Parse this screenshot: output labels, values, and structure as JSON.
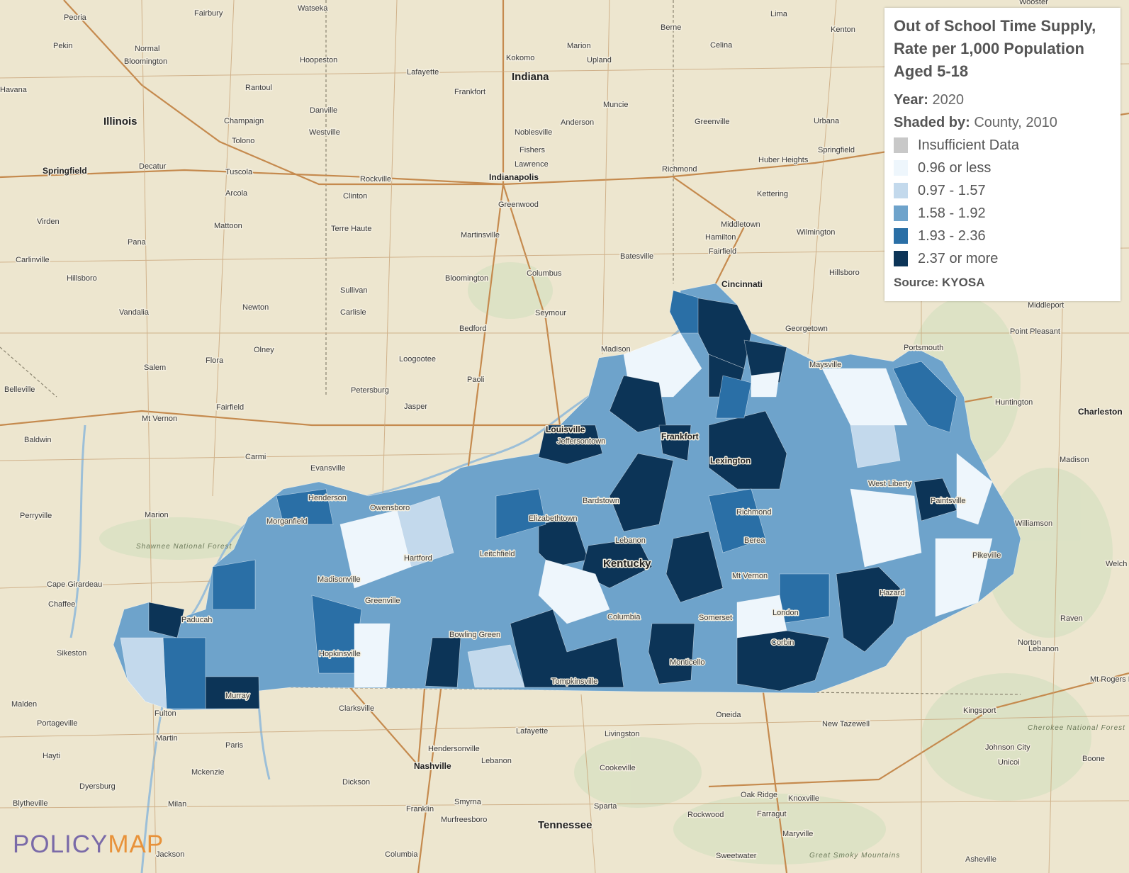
{
  "legend": {
    "title": "Out of School Time Supply, Rate per 1,000 Population Aged 5-18",
    "year_label": "Year:",
    "year_value": "2020",
    "shaded_label": "Shaded by:",
    "shaded_value": "County, 2010",
    "items": [
      {
        "label": "Insufficient Data",
        "color": "#c8c8c8"
      },
      {
        "label": "0.96 or less",
        "color": "#eef6fc"
      },
      {
        "label": "0.97 - 1.57",
        "color": "#c3d9ec"
      },
      {
        "label": "1.58 - 1.92",
        "color": "#6ea3cb"
      },
      {
        "label": "1.93 - 2.36",
        "color": "#2a6fa6"
      },
      {
        "label": "2.37 or more",
        "color": "#0c3457"
      }
    ],
    "source": "Source: KYOSA"
  },
  "logo": {
    "part1": "POLICY",
    "part2": "MAP"
  },
  "map": {
    "states": [
      "Illinois",
      "Indiana",
      "Kentucky",
      "Tennessee"
    ],
    "cities": [
      "Peoria",
      "Pekin",
      "Normal",
      "Bloomington",
      "Havana",
      "Springfield",
      "Decatur",
      "Champaign",
      "Rantoul",
      "Tolono",
      "Tuscola",
      "Arcola",
      "Mattoon",
      "Pana",
      "Virden",
      "Carlinville",
      "Hillsboro",
      "Vandalia",
      "Newton",
      "Olney",
      "Flora",
      "Salem",
      "Mt Vernon",
      "Fairfield",
      "Carmi",
      "Baldwin",
      "Belleville",
      "Perryville",
      "Marion",
      "Cape Girardeau",
      "Chaffee",
      "Sikeston",
      "Malden",
      "Portageville",
      "Hayti",
      "Blytheville",
      "Dyersburg",
      "Martin",
      "Paris",
      "Mckenzie",
      "Milan",
      "Jackson",
      "Fulton",
      "Murray",
      "Paducah",
      "Fairbury",
      "Watseka",
      "Hoopeston",
      "Danville",
      "Westville",
      "Lafayette",
      "Frankfort",
      "Kokomo",
      "Marion",
      "Upland",
      "Muncie",
      "Anderson",
      "Noblesville",
      "Fishers",
      "Lawrence",
      "Indianapolis",
      "Greenwood",
      "Martinsville",
      "Rockville",
      "Clinton",
      "Terre Haute",
      "Sullivan",
      "Carlisle",
      "Bloomington",
      "Bedford",
      "Seymour",
      "Columbus",
      "Batesville",
      "Madison",
      "Loogootee",
      "Paoli",
      "Petersburg",
      "Jasper",
      "Evansville",
      "Henderson",
      "Owensboro",
      "Morganfield",
      "Madisonville",
      "Hopkinsville",
      "Greenville",
      "Hartford",
      "Leitchfield",
      "Elizabethtown",
      "Louisville",
      "Jeffersontown",
      "Bardstown",
      "Lebanon",
      "Frankfort",
      "Lexington",
      "Richmond",
      "Berea",
      "Mt Vernon",
      "Somerset",
      "London",
      "Corbin",
      "Hazard",
      "Pikeville",
      "Paintsville",
      "West Liberty",
      "Maysville",
      "Cincinnati",
      "Columbia",
      "Monticello",
      "Tompkinsville",
      "Bowling Green",
      "Clarksville",
      "Lafayette",
      "Hendersonville",
      "Nashville",
      "Lebanon",
      "Dickson",
      "Smyrna",
      "Murfreesboro",
      "Franklin",
      "Columbia",
      "Cookeville",
      "Livingston",
      "Sparta",
      "Oneida",
      "New Tazewell",
      "Knoxville",
      "Farragut",
      "Rockwood",
      "Maryville",
      "Oak Ridge",
      "Sweetwater",
      "Kingsport",
      "Johnson City",
      "Unicoi",
      "Boone",
      "Asheville",
      "Lima",
      "Kenton",
      "Berne",
      "Celina",
      "Greenville",
      "Urbana",
      "Springfield",
      "Huber Heights",
      "Kettering",
      "Middletown",
      "Hamilton",
      "Fairfield",
      "Wilmington",
      "Richmond",
      "Georgetown",
      "Portsmouth",
      "Hillsboro",
      "Middleport",
      "Point Pleasant",
      "Huntington",
      "Charleston",
      "Madison",
      "Williamson",
      "Welch",
      "Raven",
      "Norton",
      "Lebanon",
      "Wooster",
      "Mt Rogers Recreation",
      "Cherokee National Forest",
      "Shawnee National Forest",
      "Great Smoky Mountains"
    ]
  }
}
